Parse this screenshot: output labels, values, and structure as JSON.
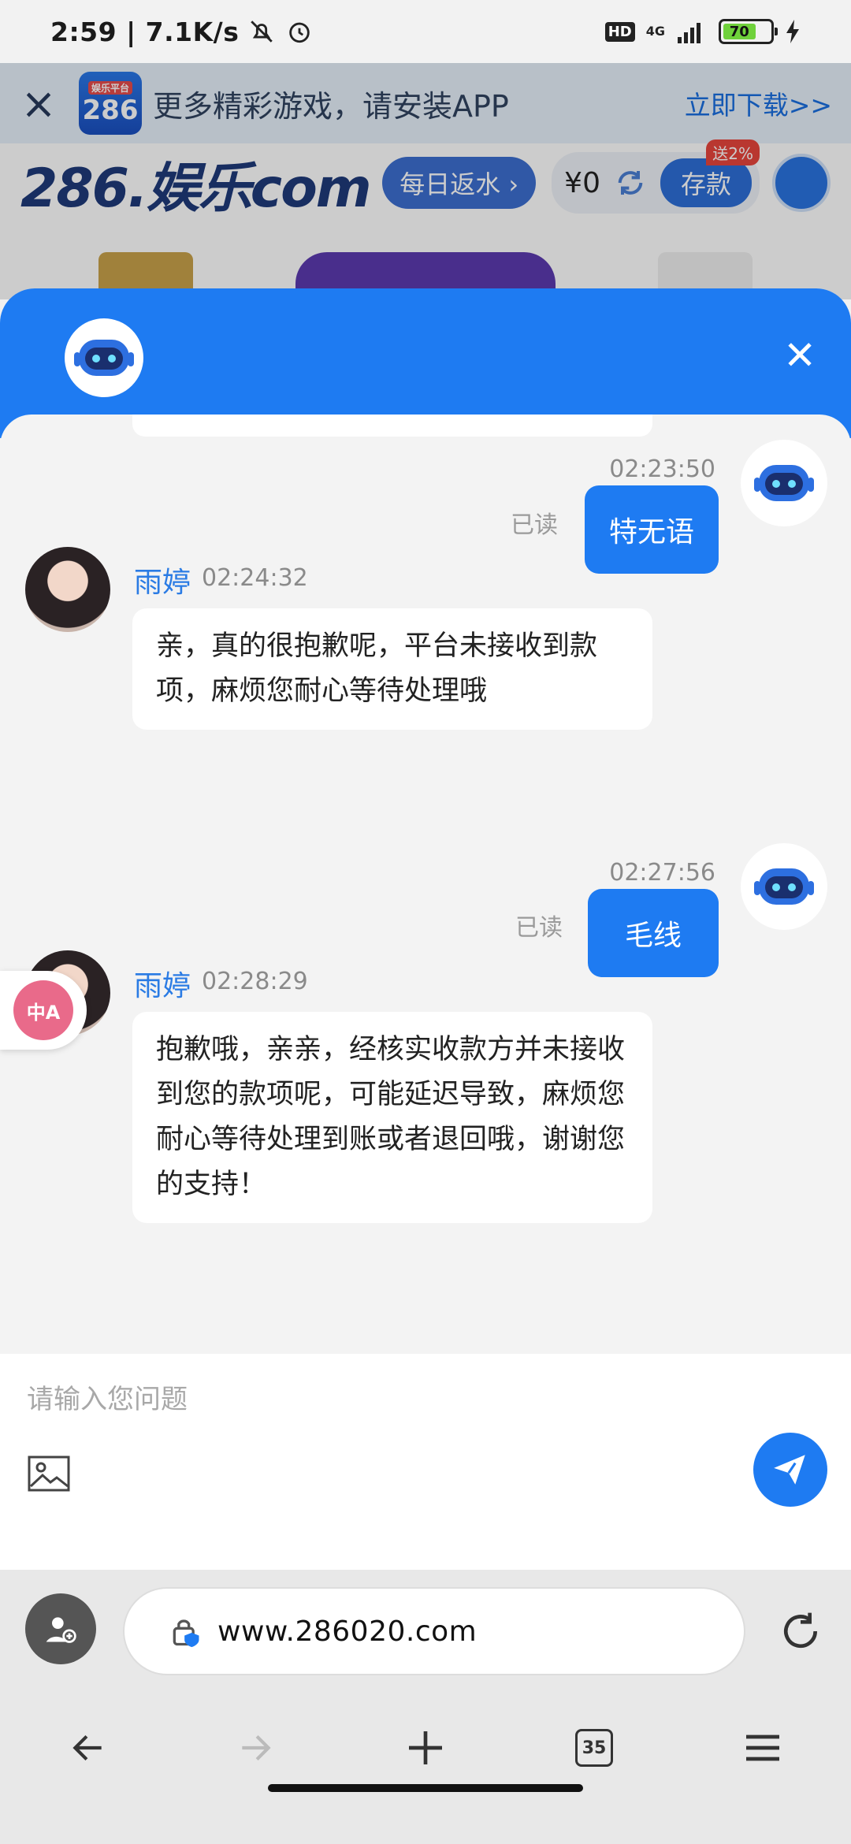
{
  "status_bar": {
    "time": "2:59 | 7.1K/s",
    "hd": "HD",
    "network": "4G",
    "battery": "70"
  },
  "site": {
    "promo_text": "更多精彩游戏，请安装APP",
    "promo_cta": "立即下载>>",
    "promo_logo": "286",
    "promo_logo_tag": "娱乐平台",
    "logo": "286.娱乐com",
    "daily_rebate": "每日返水",
    "balance": "¥0",
    "deposit": "存款",
    "deposit_tag": "送2%"
  },
  "chat": {
    "messages": [
      {
        "time": "02:23:50",
        "read": "已读",
        "text": "特无语"
      },
      {
        "agent": "雨婷",
        "time": "02:24:32",
        "text": "亲，真的很抱歉呢，平台未接收到款项，麻烦您耐心等待处理哦"
      },
      {
        "time": "02:27:56",
        "read": "已读",
        "text": "毛线"
      },
      {
        "agent": "雨婷",
        "time": "02:28:29",
        "text": "抱歉哦，亲亲，经核实收款方并未接收到您的款项呢，可能延迟导致，麻烦您耐心等待处理到账或者退回哦，谢谢您的支持！"
      }
    ],
    "input_placeholder": "请输入您问题",
    "translate_label": "中A"
  },
  "browser": {
    "url": "www.286020.com",
    "tab_count": "35"
  },
  "colors": {
    "accent": "#1e7bf2",
    "agent_name": "#2a7be4"
  }
}
